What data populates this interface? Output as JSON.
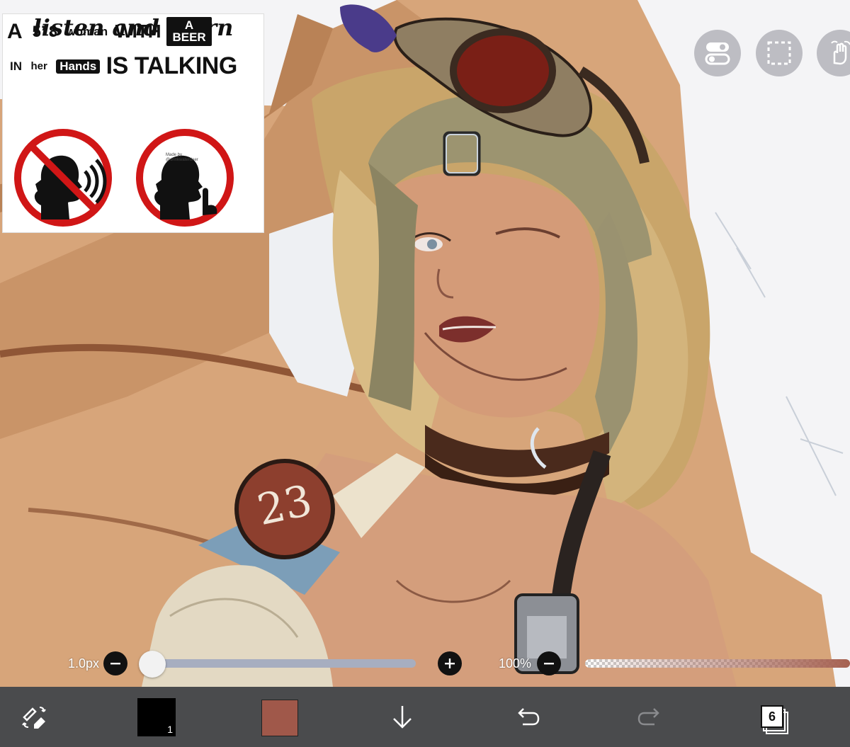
{
  "meme": {
    "l1_a": "A",
    "l1_height": "5’ 8",
    "l1_woman": "woman",
    "l1_with": "WITH",
    "l1_box_a": "A",
    "l1_box_beer": "BEER",
    "l2_in": "IN",
    "l2_her": "her",
    "l2_hands": "Hands",
    "l2_is_talking": "IS TALKING",
    "l3": "listen and learn",
    "credit": "Made by @drinkwaterdeer"
  },
  "canvas": {
    "badge_number": "23"
  },
  "sliders": {
    "brush_size_label": "1.0px",
    "brush_size_value": 0,
    "opacity_label": "100%",
    "opacity_value": 100
  },
  "toolbar": {
    "primary_layer_number": "1",
    "layers_count": "6",
    "primary_color": "#000000",
    "secondary_color": "#a0584a"
  },
  "icons": {
    "toggle": "toggle-switch-icon",
    "selection": "selection-icon",
    "gesture": "hand-gesture-icon",
    "tool_switch": "brush-eraser-switch-icon",
    "merge_down": "arrow-down-icon",
    "undo": "undo-icon",
    "redo": "redo-icon",
    "layers": "layers-icon"
  },
  "colors": {
    "toolbar_bg": "#4a4b4d",
    "tool_button_bg": "#bdbdc3",
    "slider_track": "#a7aec0"
  }
}
